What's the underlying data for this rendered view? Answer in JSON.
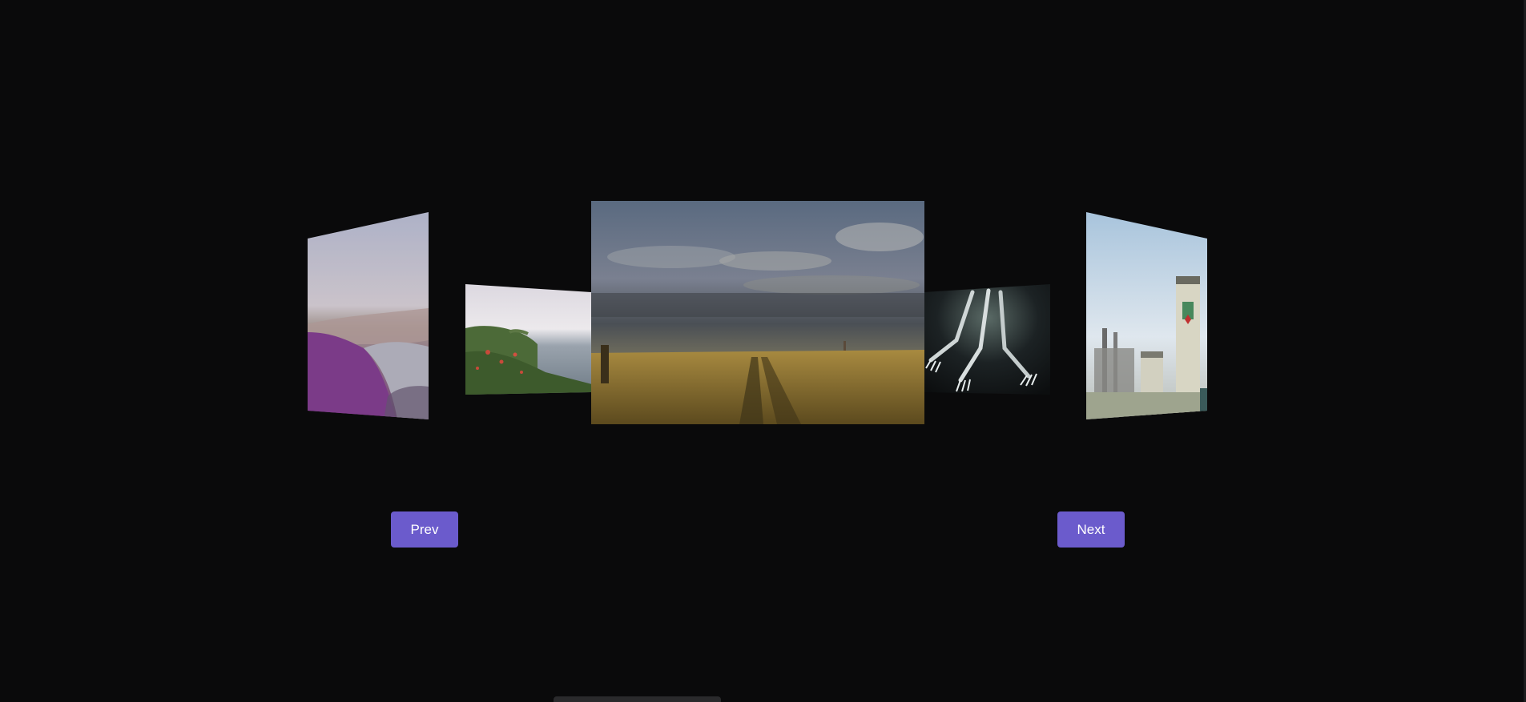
{
  "carousel": {
    "slides": [
      {
        "name": "coastal-valley-photo",
        "position": "far-left",
        "tint": "#8a4a9a"
      },
      {
        "name": "seaside-cliff-photo",
        "position": "left",
        "tint": "#5a7a45"
      },
      {
        "name": "grassland-path-photo",
        "position": "center",
        "tint": "#8a7a40"
      },
      {
        "name": "forks-photo",
        "position": "right",
        "tint": "#222a2c"
      },
      {
        "name": "industrial-silo-photo",
        "position": "far-right",
        "tint": "#c8ccc4"
      }
    ],
    "active_index": 2
  },
  "controls": {
    "prev_label": "Prev",
    "next_label": "Next",
    "button_color": "#6b5bcc"
  }
}
